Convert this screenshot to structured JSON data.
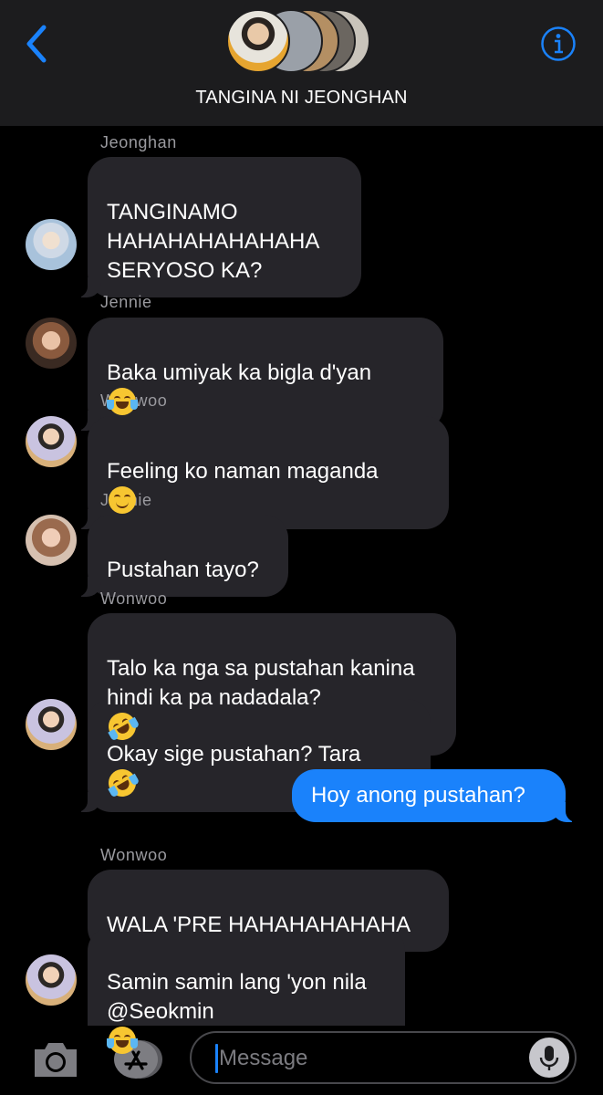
{
  "header": {
    "title": "TANGINA NI JEONGHAN",
    "back_icon": "chevron-left-icon",
    "info_icon": "info-circle-icon"
  },
  "colors": {
    "accent": "#1a82fb",
    "incoming_bubble": "#26252a",
    "header_bg": "#1c1c1e",
    "sender_name": "#9a9a9f"
  },
  "messages": [
    {
      "sender": "Jeonghan",
      "text": "TANGINAMO\nHAHAHAHAHAHAHA\nSERYOSO KA?"
    },
    {
      "sender": "Jennie",
      "text": "Baka umiyak ka bigla d'yan",
      "emoji": "face-with-tears-of-joy"
    },
    {
      "sender": "Wonwoo",
      "text": "Feeling ko naman maganda",
      "emoji": "relieved-face"
    },
    {
      "sender": "Jennie",
      "text": "Pustahan tayo?"
    },
    {
      "sender": "Wonwoo",
      "text": "Talo ka nga sa pustahan kanina\nhindi ka pa nadadala?",
      "emoji": "rolling-on-floor-laughing"
    },
    {
      "sender": "",
      "text": "Okay sige pustahan? Tara",
      "emoji": "rolling-on-floor-laughing"
    },
    {
      "sender": "me",
      "text": "Hoy anong pustahan?"
    },
    {
      "sender": "Wonwoo",
      "text": "WALA 'PRE HAHAHAHAHAHA"
    },
    {
      "sender": "",
      "text": "Samin samin lang 'yon nila\n@Seokmin",
      "emoji": "face-with-tears-of-joy"
    }
  ],
  "input": {
    "placeholder": "Message",
    "camera_icon": "camera-icon",
    "apps_icon": "app-store-icon",
    "mic_icon": "microphone-icon"
  }
}
